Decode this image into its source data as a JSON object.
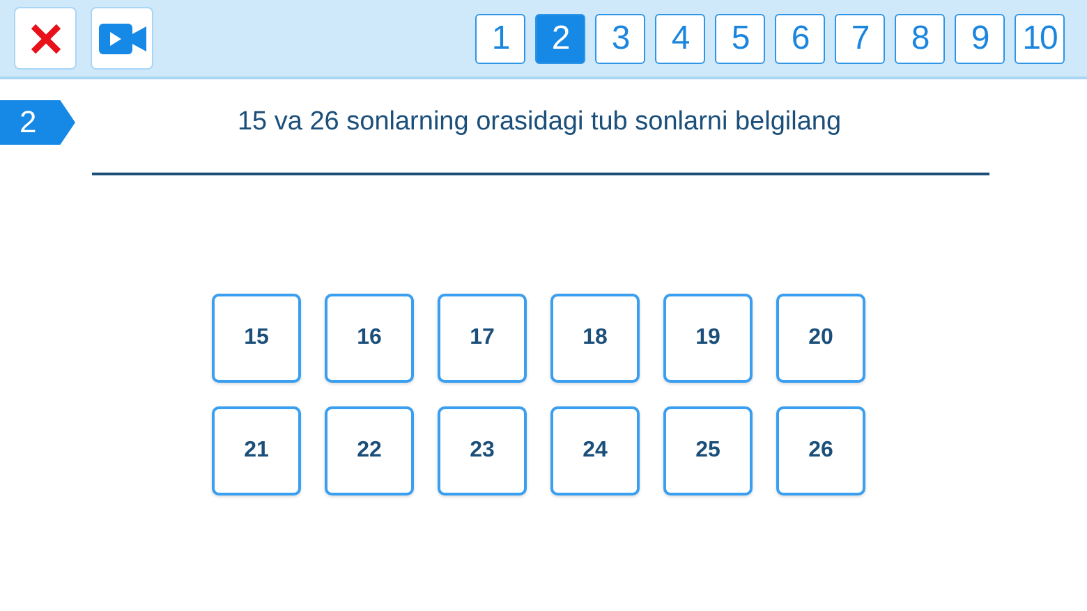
{
  "toolbar": {
    "tabs": [
      {
        "label": "1",
        "selected": false
      },
      {
        "label": "2",
        "selected": true
      },
      {
        "label": "3",
        "selected": false
      },
      {
        "label": "4",
        "selected": false
      },
      {
        "label": "5",
        "selected": false
      },
      {
        "label": "6",
        "selected": false
      },
      {
        "label": "7",
        "selected": false
      },
      {
        "label": "8",
        "selected": false
      },
      {
        "label": "9",
        "selected": false
      },
      {
        "label": "10",
        "selected": false
      }
    ]
  },
  "question": {
    "number": "2",
    "text": "15 va 26 sonlarning orasidagi tub sonlarni belgilang"
  },
  "options": [
    {
      "label": "15",
      "selected": false
    },
    {
      "label": "16",
      "selected": false
    },
    {
      "label": "17",
      "selected": false
    },
    {
      "label": "18",
      "selected": false
    },
    {
      "label": "19",
      "selected": false
    },
    {
      "label": "20",
      "selected": false
    },
    {
      "label": "21",
      "selected": false
    },
    {
      "label": "22",
      "selected": false
    },
    {
      "label": "23",
      "selected": false
    },
    {
      "label": "24",
      "selected": false
    },
    {
      "label": "25",
      "selected": false
    },
    {
      "label": "26",
      "selected": false
    }
  ]
}
